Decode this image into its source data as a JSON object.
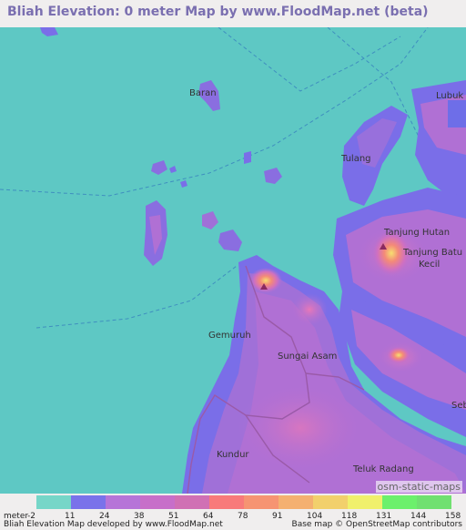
{
  "title": "Bliah Elevation: 0 meter Map by www.FloodMap.net (beta)",
  "places": {
    "baran": "Baran",
    "lubuk": "Lubuk",
    "tulang": "Tulang",
    "tanjung_hutan": "Tanjung Hutan",
    "tanjung_batu_kecil_1": "Tanjung Batu",
    "tanjung_batu_kecil_2": "Kecil",
    "gemuruh": "Gemuruh",
    "sungai_asam": "Sungai Asam",
    "seb": "Seb",
    "kundur": "Kundur",
    "teluk_radang": "Teluk Radang"
  },
  "osm_attribution": "osm-static-maps",
  "legend": {
    "unit_label": "meter",
    "ticks": [
      "-2",
      "11",
      "24",
      "38",
      "51",
      "64",
      "78",
      "91",
      "104",
      "118",
      "131",
      "144",
      "158"
    ],
    "colors": [
      "#76d6c8",
      "#7a72ea",
      "#b674d8",
      "#c76fc9",
      "#d070b4",
      "#f87a7a",
      "#f69472",
      "#f4b070",
      "#f2d06c",
      "#f0f06c",
      "#6cf06c",
      "#70e070"
    ]
  },
  "credits": {
    "left": "Bliah Elevation Map developed by www.FloodMap.net",
    "right": "Base map © OpenStreetMap contributors"
  },
  "colors": {
    "sea": "#5ec8c4",
    "low_land": "#6e6ee8",
    "mid_land": "#b070d4",
    "high_land": "#e070b0",
    "peak": "#f6d470"
  }
}
